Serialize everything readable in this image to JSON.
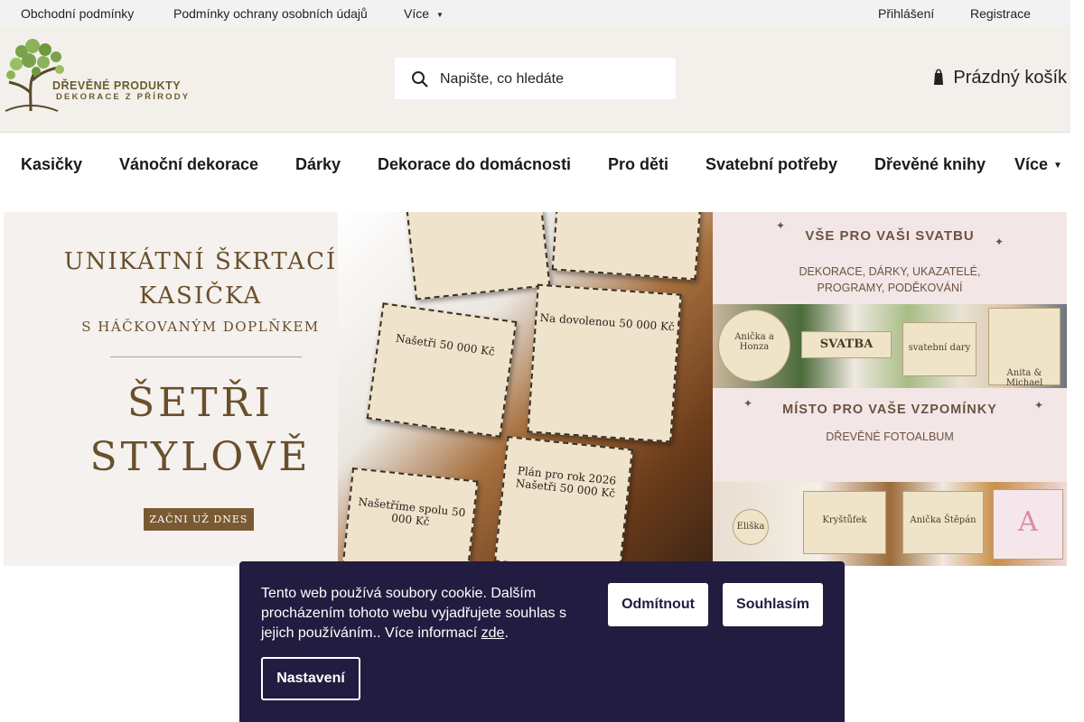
{
  "topbar": {
    "links": [
      "Obchodní podmínky",
      "Podmínky ochrany osobních údajů",
      "Více"
    ],
    "account": {
      "login": "Přihlášení",
      "register": "Registrace"
    }
  },
  "header": {
    "logo": {
      "title": "DŘEVĚNÉ PRODUKTY",
      "subtitle": "DEKORACE Z PŘÍRODY"
    },
    "search": {
      "placeholder": "Napište, co hledáte",
      "value": ""
    },
    "cart": {
      "label": "Prázdný košík"
    }
  },
  "nav": {
    "items": [
      "Kasičky",
      "Vánoční dekorace",
      "Dárky",
      "Dekorace do domácnosti",
      "Pro děti",
      "Svatební potřeby",
      "Dřevěné knihy",
      "Více"
    ]
  },
  "banner_left": {
    "line1": "UNIKÁTNÍ ŠKRTACÍ",
    "line2": "KASIČKA",
    "line3": "S HÁČKOVANÝM DOPLŇKEM",
    "line4": "ŠETŘI",
    "line5": "STYLOVĚ",
    "cta": "ZAČNI UŽ DNES",
    "boxes": [
      "Našetři 50 000 Kč",
      "Na dovolenou 50 000 Kč",
      "Našetříme spolu 50 000 Kč",
      "Plán pro rok 2026 Našetři 50 000 Kč"
    ]
  },
  "banner_right": {
    "top_heading": "VŠE PRO VAŠI SVATBU",
    "top_sub_line1": "DEKORACE, DÁRKY, UKAZATELÉ,",
    "top_sub_line2": "PROGRAMY, PODĚKOVÁNÍ",
    "strip1_items": [
      "Anička a Honza",
      "SVATBA",
      "svatební dary",
      "Anita & Michael"
    ],
    "mid_heading": "MÍSTO PRO VAŠE VZPOMÍNKY",
    "mid_sub": "DŘEVĚNÉ FOTOALBUM",
    "strip2_items": [
      "Eliška",
      "Kryštůfek",
      "Anička Štěpán",
      "A"
    ]
  },
  "cookie": {
    "text": "Tento web používá soubory cookie. Dalším procházením tohoto webu vyjadřujete souhlas s jejich používáním.. Více informací ",
    "link": "zde",
    "after": ".",
    "reject": "Odmítnout",
    "accept": "Souhlasím",
    "settings": "Nastavení"
  }
}
